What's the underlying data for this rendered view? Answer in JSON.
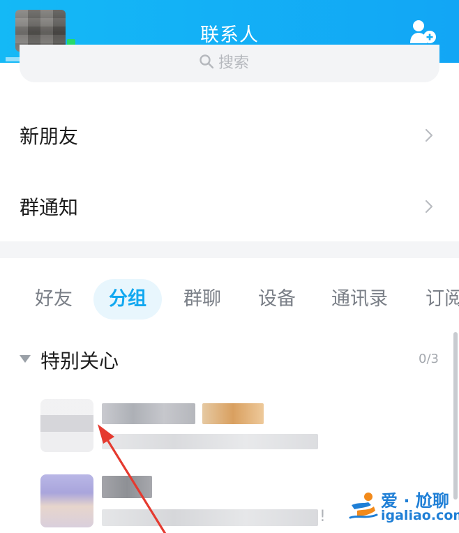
{
  "header": {
    "title": "联系人",
    "add_contact_icon": "add-contact-icon"
  },
  "search": {
    "placeholder": "搜索"
  },
  "entries": {
    "new_friends": "新朋友",
    "group_notifications": "群通知"
  },
  "tabs": [
    {
      "label": "好友",
      "active": false
    },
    {
      "label": "分组",
      "active": true
    },
    {
      "label": "群聊",
      "active": false
    },
    {
      "label": "设备",
      "active": false
    },
    {
      "label": "通讯录",
      "active": false
    },
    {
      "label": "订阅",
      "active": false
    }
  ],
  "group": {
    "name": "特别关心",
    "count": "0/3"
  },
  "contacts_second_row_end": "!",
  "watermark": {
    "top": "爱 · 尬聊",
    "bottom": "igaliao.com"
  },
  "colors": {
    "header_bg": "#14b9f6",
    "accent": "#12a8f0",
    "online": "#27d86b",
    "annotation_arrow": "#e53a2f"
  }
}
